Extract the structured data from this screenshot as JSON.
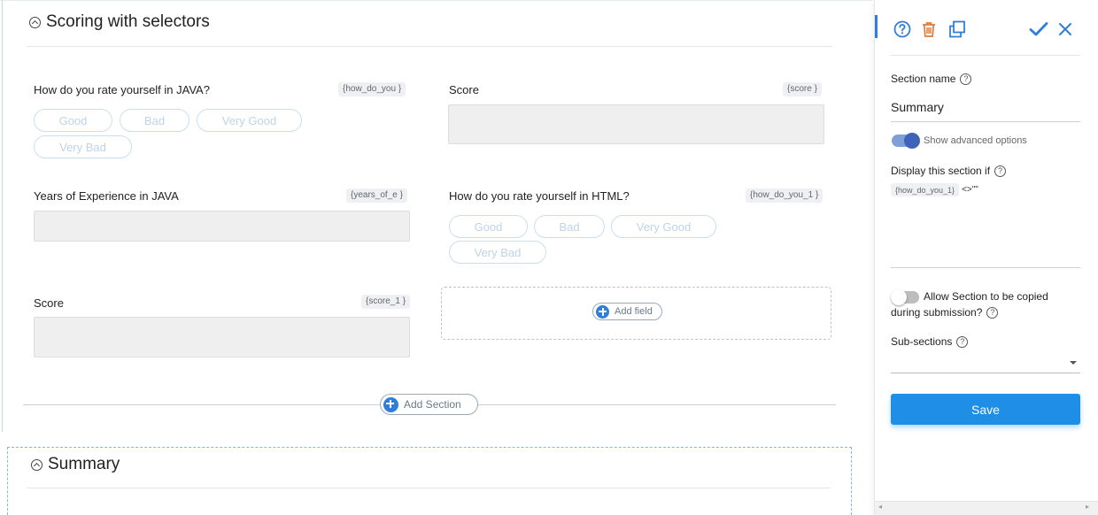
{
  "section1": {
    "title": "Scoring with selectors",
    "q1": {
      "label": "How do you rate yourself in JAVA?",
      "tag": "{how_do_you }",
      "options": [
        "Good",
        "Bad",
        "Very Good",
        "Very Bad"
      ]
    },
    "score1": {
      "label": "Score",
      "tag": "{score }"
    },
    "years": {
      "label": "Years of Experience in JAVA",
      "tag": "{years_of_e }"
    },
    "q2": {
      "label": "How do you rate yourself in HTML?",
      "tag": "{how_do_you_1 }",
      "options": [
        "Good",
        "Bad",
        "Very Good",
        "Very Bad"
      ]
    },
    "score2": {
      "label": "Score",
      "tag": "{score_1 }"
    },
    "add_field_label": "Add field"
  },
  "add_section_label": "Add Section",
  "section2": {
    "title": "Summary"
  },
  "panel": {
    "icons": [
      "help-icon",
      "trash-icon",
      "copy-icon",
      "check-icon",
      "close-icon"
    ],
    "section_name_label": "Section name",
    "section_name_value": "Summary",
    "advanced_label": "Show advanced options",
    "advanced_on": true,
    "display_if_label": "Display this section if",
    "condition_tag": "{how_do_you_1}",
    "condition_rest": "<>\"\"",
    "allow_copy_label_line1": "Allow Section to be copied",
    "allow_copy_label_line2": "during submission?",
    "allow_copy_on": false,
    "subsections_label": "Sub-sections",
    "save_label": "Save"
  },
  "colors": {
    "accent": "#2f7fd8",
    "save": "#1e8ee6",
    "trash": "#e07b39",
    "check": "#2f7fd8"
  }
}
